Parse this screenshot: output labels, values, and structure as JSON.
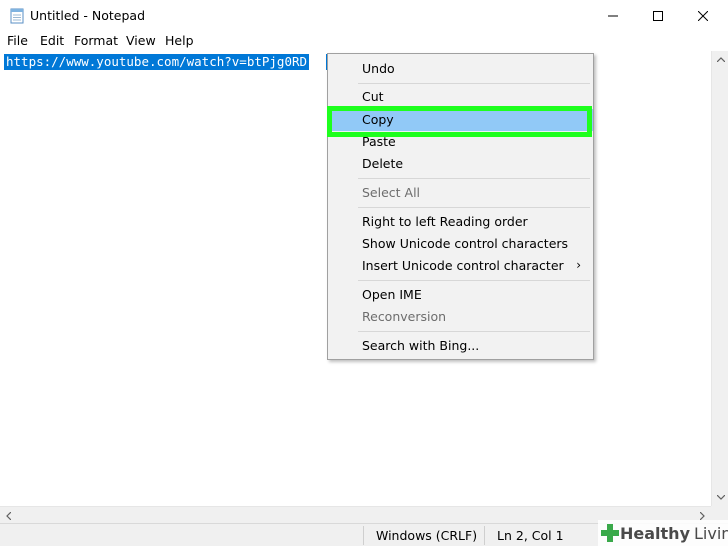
{
  "window": {
    "title": "Untitled - Notepad",
    "icon": "notepad-icon"
  },
  "menubar": {
    "file": "File",
    "edit": "Edit",
    "format": "Format",
    "view": "View",
    "help": "Help"
  },
  "editor": {
    "selected_text": "https://www.youtube.com/watch?v=btPjg0RD"
  },
  "context_menu": {
    "items": [
      {
        "label": "Undo",
        "enabled": true
      },
      {
        "label": "Cut",
        "enabled": true
      },
      {
        "label": "Copy",
        "enabled": true,
        "highlighted": true
      },
      {
        "label": "Paste",
        "enabled": true
      },
      {
        "label": "Delete",
        "enabled": true
      },
      {
        "label": "Select All",
        "enabled": false
      },
      {
        "label": "Right to left Reading order",
        "enabled": true
      },
      {
        "label": "Show Unicode control characters",
        "enabled": true
      },
      {
        "label": "Insert Unicode control character",
        "enabled": true,
        "submenu": true
      },
      {
        "label": "Open IME",
        "enabled": true
      },
      {
        "label": "Reconversion",
        "enabled": false
      },
      {
        "label": "Search with Bing...",
        "enabled": true
      }
    ],
    "submenu_glyph": "›"
  },
  "statusbar": {
    "line_ending": "Windows (CRLF)",
    "position": "Ln 2, Col 1"
  },
  "watermark": {
    "brand": "Healthy",
    "brand2": "Living"
  },
  "colors": {
    "selection": "#0078d7",
    "menu_highlight": "#91c9f7",
    "callout": "#1eff1e"
  }
}
